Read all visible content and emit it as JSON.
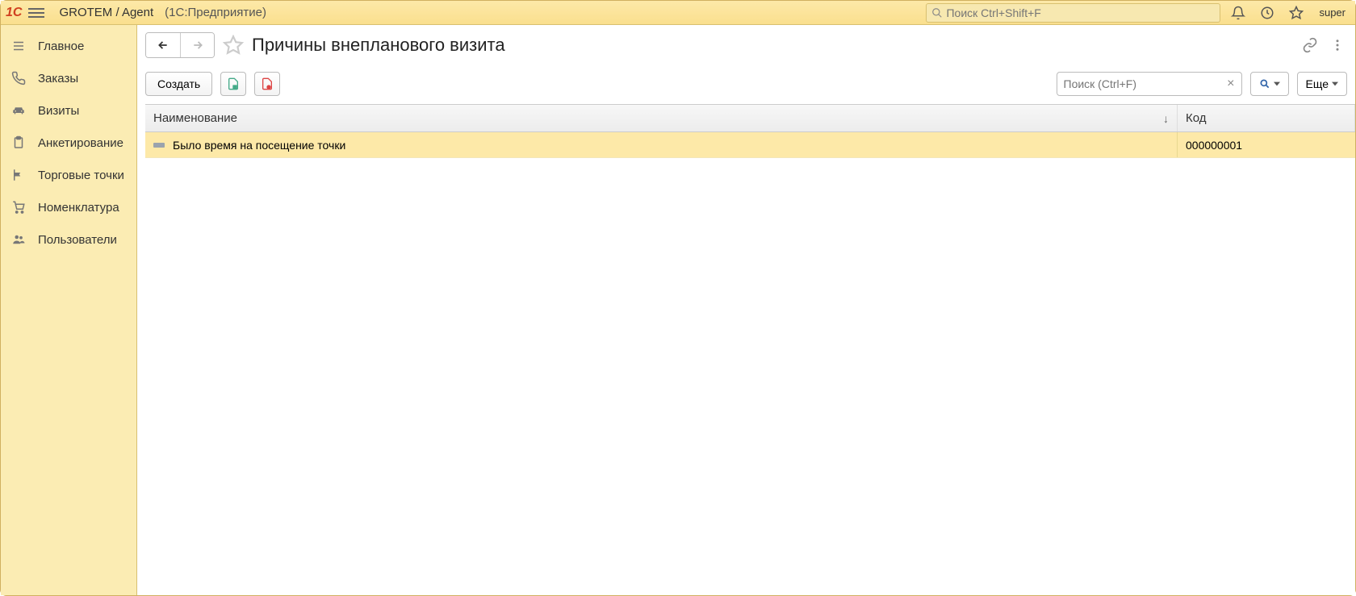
{
  "header": {
    "logo_text": "1С",
    "app_name": "GROTEM / Agent",
    "app_suffix": "(1C:Предприятие)",
    "global_search_placeholder": "Поиск Ctrl+Shift+F",
    "user": "super"
  },
  "sidebar": {
    "items": [
      {
        "label": "Главное",
        "icon": "home"
      },
      {
        "label": "Заказы",
        "icon": "phone"
      },
      {
        "label": "Визиты",
        "icon": "car"
      },
      {
        "label": "Анкетирование",
        "icon": "clipboard"
      },
      {
        "label": "Торговые точки",
        "icon": "flag"
      },
      {
        "label": "Номенклатура",
        "icon": "cart"
      },
      {
        "label": "Пользователи",
        "icon": "users"
      }
    ]
  },
  "page": {
    "title": "Причины внепланового визита"
  },
  "toolbar": {
    "create_label": "Создать",
    "local_search_placeholder": "Поиск (Ctrl+F)",
    "more_label": "Еще"
  },
  "table": {
    "columns": {
      "name": "Наименование",
      "code": "Код"
    },
    "rows": [
      {
        "name": "Было время на посещение точки",
        "code": "000000001"
      }
    ]
  }
}
